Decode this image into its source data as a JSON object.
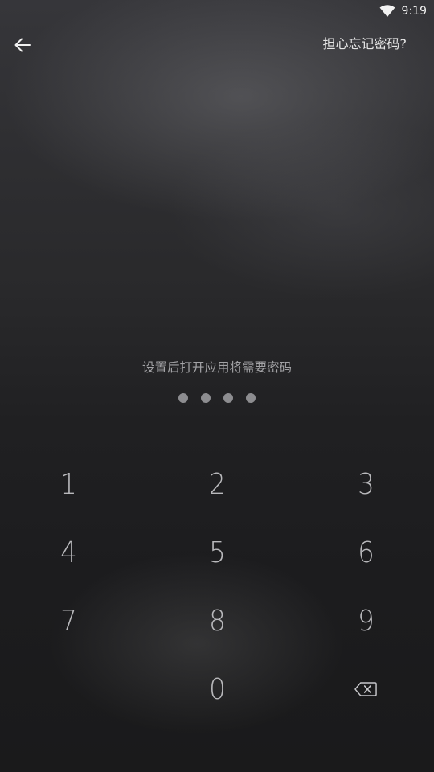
{
  "status_bar": {
    "time": "9:19",
    "wifi_icon": "wifi-icon"
  },
  "header": {
    "back_icon": "arrow-left-icon",
    "forgot_password_label": "担心忘记密码?"
  },
  "prompt": {
    "text": "设置后打开应用将需要密码",
    "pin_length": 4,
    "entered_digits": 0
  },
  "keypad": {
    "keys": [
      "1",
      "2",
      "3",
      "4",
      "5",
      "6",
      "7",
      "8",
      "9",
      "0"
    ],
    "backspace_icon": "backspace-icon"
  },
  "colors": {
    "background_top": "#36363a",
    "background_bottom": "#1a1a1b",
    "key_text": "#b9b9bc",
    "prompt_text": "#a3a3a6",
    "dot": "#8d8d90",
    "header_text": "#e6e6e6"
  }
}
